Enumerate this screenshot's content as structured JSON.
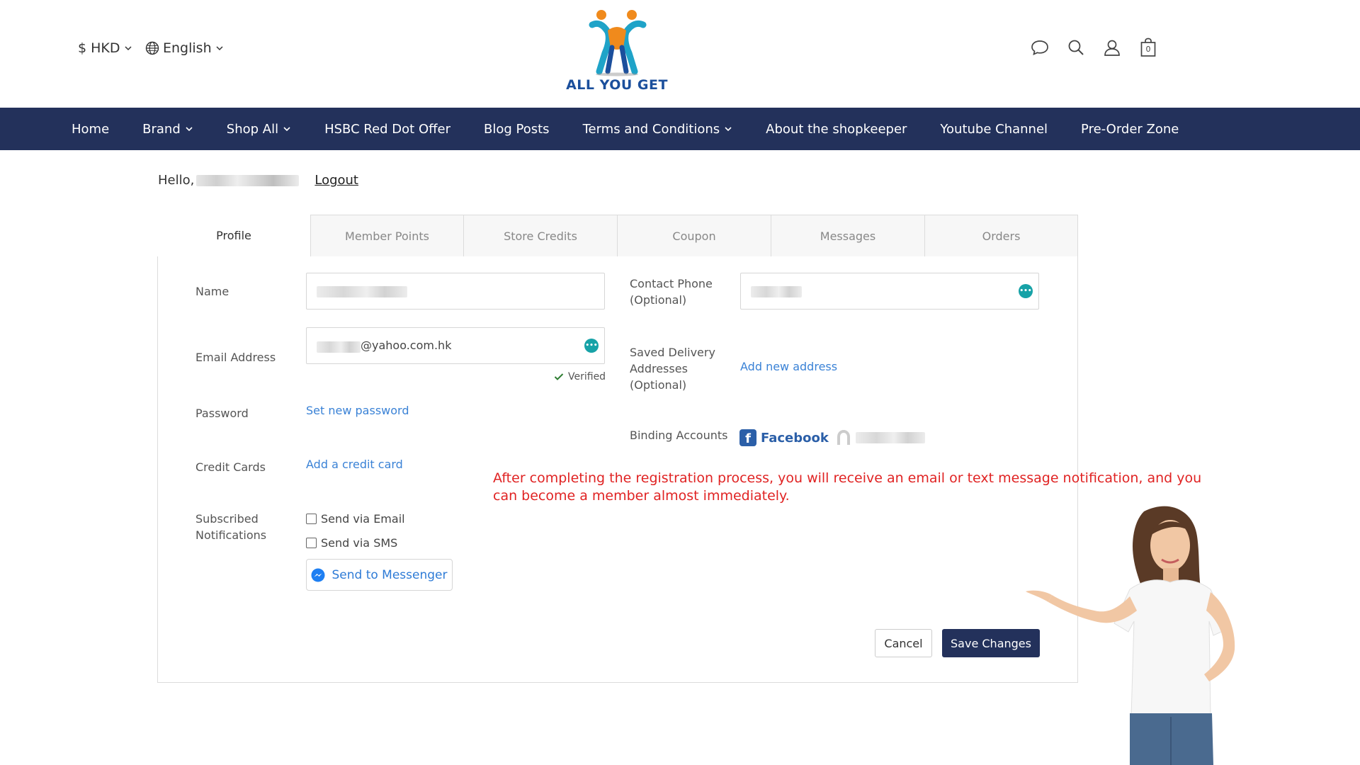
{
  "header": {
    "currency": "$ HKD",
    "language": "English",
    "logo_text": "ALL YOU GET",
    "icons": [
      "chat-icon",
      "search-icon",
      "user-icon",
      "cart-icon"
    ],
    "cart_count": "0"
  },
  "nav": {
    "items": [
      {
        "label": "Home",
        "dropdown": false
      },
      {
        "label": "Brand",
        "dropdown": true
      },
      {
        "label": "Shop All",
        "dropdown": true
      },
      {
        "label": "HSBC Red Dot Offer",
        "dropdown": false
      },
      {
        "label": "Blog Posts",
        "dropdown": false
      },
      {
        "label": "Terms and Conditions",
        "dropdown": true
      },
      {
        "label": "About the shopkeeper",
        "dropdown": false
      },
      {
        "label": "Youtube Channel",
        "dropdown": false
      },
      {
        "label": "Pre-Order Zone",
        "dropdown": false
      }
    ]
  },
  "greeting": {
    "hello": "Hello,",
    "logout": "Logout"
  },
  "tabs": [
    "Profile",
    "Member Points",
    "Store Credits",
    "Coupon",
    "Messages",
    "Orders"
  ],
  "active_tab": "Profile",
  "profile": {
    "name_label": "Name",
    "email_label": "Email Address",
    "email_value": "@yahoo.com.hk",
    "verified": "Verified",
    "password_label": "Password",
    "set_password": "Set new password",
    "credit_label": "Credit Cards",
    "add_credit": "Add a credit card",
    "notifications_label_1": "Subscribed",
    "notifications_label_2": "Notifications",
    "send_email": "Send via Email",
    "send_sms": "Send via SMS",
    "messenger": "Send to Messenger",
    "phone_label_1": "Contact Phone",
    "phone_label_2": "(Optional)",
    "addr_label_1": "Saved Delivery",
    "addr_label_2": "Addresses",
    "addr_label_3": "(Optional)",
    "add_address": "Add new address",
    "binding_label": "Binding Accounts",
    "facebook": "Facebook",
    "cancel": "Cancel",
    "save": "Save Changes"
  },
  "notice": "After completing the registration process, you will receive an email or text message notification, and you can become a member almost immediately.",
  "colors": {
    "nav_bg": "#23315b",
    "link": "#3a82d6",
    "notice": "#e02323",
    "badge": "#17a2a7",
    "facebook": "#2b5fa8"
  }
}
